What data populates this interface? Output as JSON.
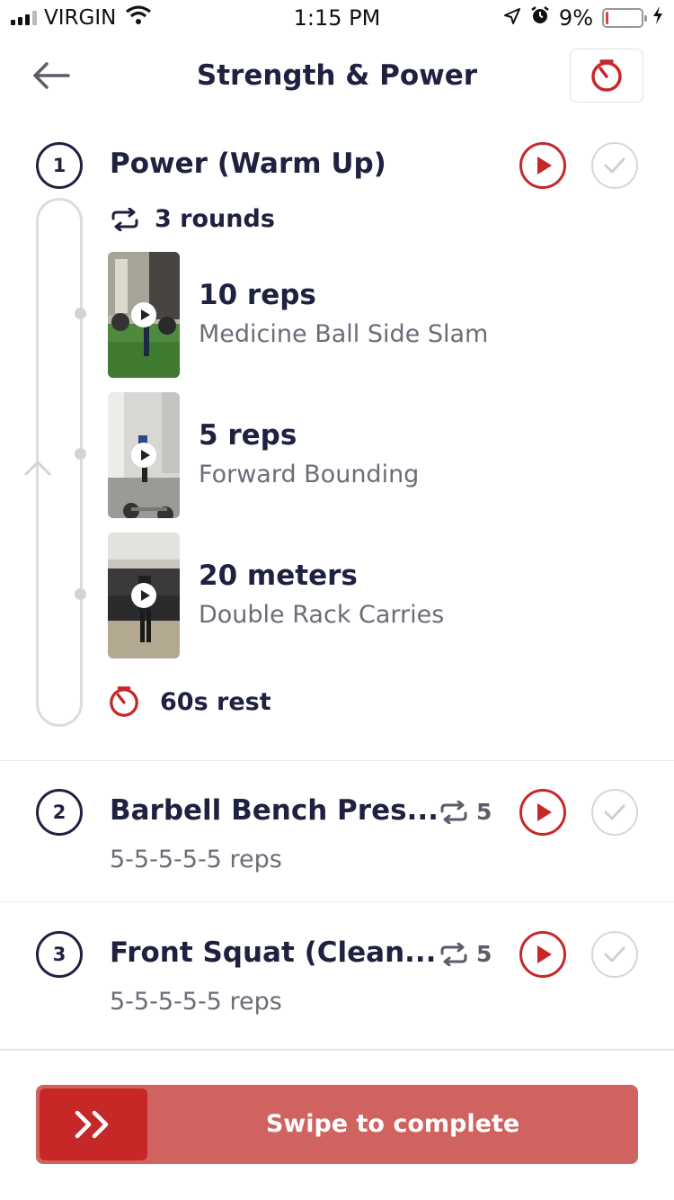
{
  "status_bar": {
    "carrier": "VIRGIN",
    "time": "1:15 PM",
    "battery_percent": "9%",
    "battery_level": 0.09,
    "icons": [
      "signal-icon",
      "wifi-icon",
      "location-icon",
      "alarm-icon",
      "battery-icon",
      "charging-icon"
    ]
  },
  "header": {
    "title": "Strength & Power",
    "back_icon": "back-arrow-icon",
    "timer_icon": "timer-icon"
  },
  "sections": [
    {
      "number": "1",
      "title": "Power (Warm Up)",
      "rounds_label": "3 rounds",
      "exercises": [
        {
          "quantity": "10 reps",
          "name": "Medicine Ball Side Slam"
        },
        {
          "quantity": "5 reps",
          "name": "Forward Bounding"
        },
        {
          "quantity": "20 meters",
          "name": "Double Rack Carries"
        }
      ],
      "rest_label": "60s rest"
    },
    {
      "number": "2",
      "title": "Barbell Bench Pres...",
      "rounds": "5",
      "reps": "5-5-5-5-5 reps"
    },
    {
      "number": "3",
      "title": "Front Squat (Clean...",
      "rounds": "5",
      "reps": "5-5-5-5-5 reps"
    }
  ],
  "footer": {
    "swipe_label": "Swipe to complete",
    "handle_icon": "double-chevron-right-icon"
  },
  "colors": {
    "accent": "#c62828",
    "swipe_bg": "#d06360",
    "text_dark": "#1e2240",
    "text_muted": "#6b6d78"
  }
}
